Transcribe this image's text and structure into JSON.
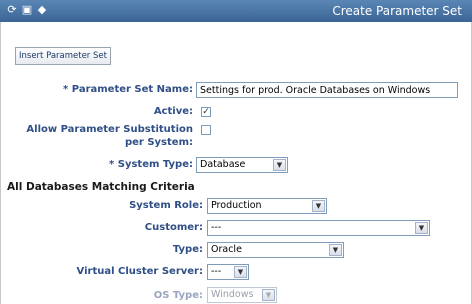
{
  "window": {
    "title": "Create Parameter Set",
    "icons": [
      "refresh-icon",
      "save-icon",
      "diamond-icon"
    ]
  },
  "toolbar": {
    "insert_label": "Insert Parameter Set"
  },
  "form": {
    "param_set_name_label": "* Parameter Set Name:",
    "param_set_name_value": "Settings for prod. Oracle Databases on Windows",
    "active_label": "Active:",
    "active_checked": "✓",
    "allow_sub_label_1": "Allow Parameter Substitution",
    "allow_sub_label_2": "per System:",
    "system_type_label": "* System Type:",
    "system_type_value": "Database"
  },
  "criteria": {
    "heading": "All Databases Matching Criteria",
    "system_role_label": "System Role:",
    "system_role_value": "Production",
    "customer_label": "Customer:",
    "customer_value": "---",
    "type_label": "Type:",
    "type_value": "Oracle",
    "vcs_label": "Virtual Cluster Server:",
    "vcs_value": "---",
    "os_type_label": "OS Type:",
    "os_type_value": "Windows"
  }
}
